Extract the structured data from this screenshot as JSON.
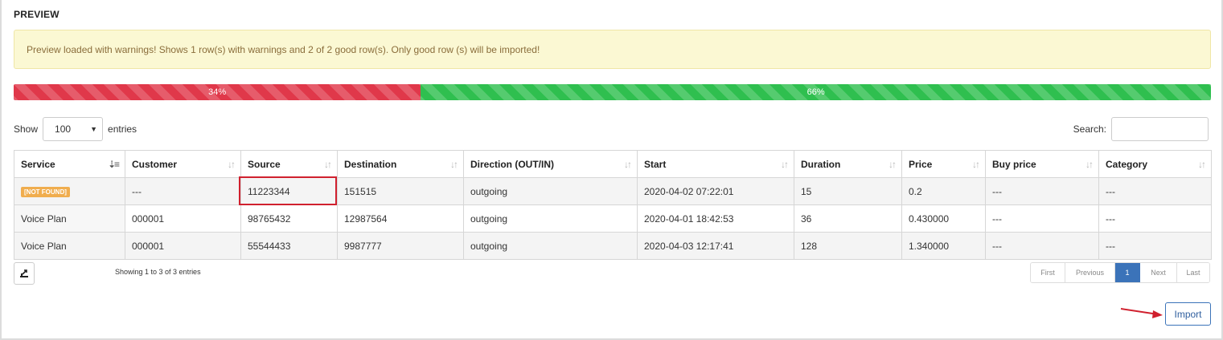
{
  "section_title": "PREVIEW",
  "alert_message": "Preview loaded with warnings! Shows 1 row(s) with warnings and 2 of 2 good row(s). Only good row (s) will be imported!",
  "progress": {
    "warning_label": "34%",
    "warning_fraction": 0.34,
    "good_label": "66%",
    "good_fraction": 0.66
  },
  "length_control": {
    "show_label": "Show",
    "selected": "100",
    "entries_label": "entries"
  },
  "search": {
    "label": "Search:",
    "value": ""
  },
  "table": {
    "columns": [
      "Service",
      "Customer",
      "Source",
      "Destination",
      "Direction (OUT/IN)",
      "Start",
      "Duration",
      "Price",
      "Buy price",
      "Category"
    ],
    "rows": [
      {
        "service_badge": "[NOT FOUND]",
        "customer": "---",
        "source": "11223344",
        "destination": "151515",
        "direction": "outgoing",
        "start": "2020-04-02 07:22:01",
        "duration": "15",
        "price": "0.2",
        "buy_price": "---",
        "category": "---"
      },
      {
        "service": "Voice Plan",
        "customer": "000001",
        "source": "98765432",
        "destination": "12987564",
        "direction": "outgoing",
        "start": "2020-04-01 18:42:53",
        "duration": "36",
        "price": "0.430000",
        "buy_price": "---",
        "category": "---"
      },
      {
        "service": "Voice Plan",
        "customer": "000001",
        "source": "55544433",
        "destination": "9987777",
        "direction": "outgoing",
        "start": "2020-04-03 12:17:41",
        "duration": "128",
        "price": "1.340000",
        "buy_price": "---",
        "category": "---"
      }
    ]
  },
  "footer": {
    "info": "Showing 1 to 3 of 3 entries",
    "pager": {
      "first": "First",
      "previous": "Previous",
      "current": "1",
      "next": "Next",
      "last": "Last"
    },
    "export_icon": "export-icon"
  },
  "import_button": "Import",
  "colors": {
    "warning_bar": "#e0384a",
    "good_bar": "#2fbf4f",
    "alert_bg": "#fbf8d3",
    "badge": "#f0ad4e",
    "accent": "#3b73b9",
    "annotation": "#d0202e"
  }
}
